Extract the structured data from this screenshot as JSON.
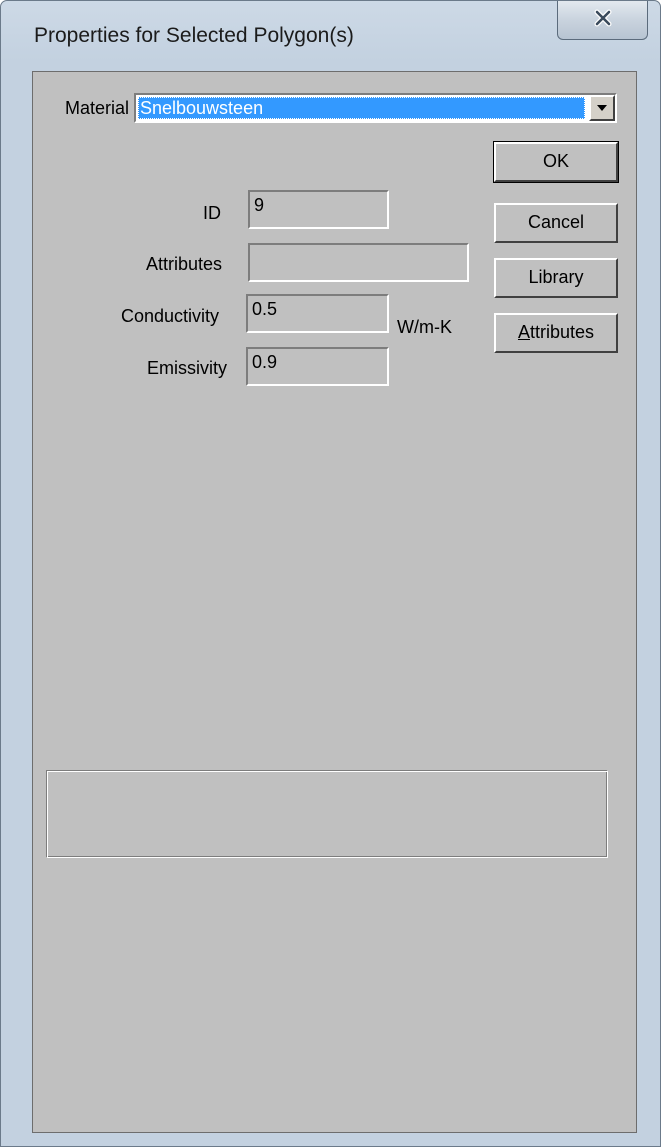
{
  "window": {
    "title": "Properties for Selected Polygon(s)"
  },
  "material": {
    "label": "Material",
    "selected": "Snelbouwsteen"
  },
  "fields": {
    "id": {
      "label": "ID",
      "value": "9"
    },
    "attributes": {
      "label": "Attributes",
      "value": ""
    },
    "conductivity": {
      "label": "Conductivity",
      "value": "0.5",
      "unit": "W/m-K"
    },
    "emissivity": {
      "label": "Emissivity",
      "value": "0.9"
    }
  },
  "buttons": {
    "ok": "OK",
    "cancel": "Cancel",
    "library": "Library",
    "attributes_mnemonic": "A",
    "attributes_rest": "ttributes"
  },
  "icons": {
    "close": "close-icon",
    "dropdown": "chevron-down-icon"
  },
  "colors": {
    "dialog_face": "#c0c0c0",
    "selection": "#3399ff",
    "titlebar": "#c3d1e0"
  }
}
